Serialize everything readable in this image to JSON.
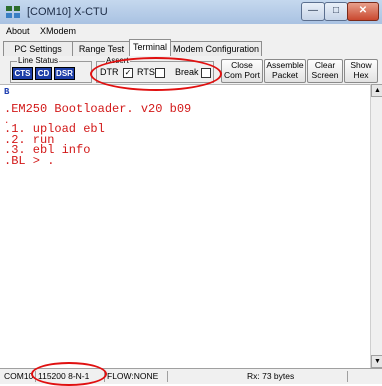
{
  "window": {
    "title": "[COM10] X-CTU",
    "min_glyph": "—",
    "max_glyph": "□",
    "close_glyph": "✕"
  },
  "menu": [
    "About",
    "XModem"
  ],
  "tabs": [
    {
      "label": "PC Settings",
      "active": false
    },
    {
      "label": "Range Test",
      "active": false
    },
    {
      "label": "Terminal",
      "active": true
    },
    {
      "label": "Modem Configuration",
      "active": false
    }
  ],
  "line_status": {
    "label": "Line Status",
    "indicators": [
      "CTS",
      "CD",
      "DSR"
    ]
  },
  "assert": {
    "label": "Assert",
    "dtr": {
      "label": "DTR",
      "checked": true,
      "mark": "✓"
    },
    "rts": {
      "label": "RTS",
      "checked": false
    },
    "break": {
      "label": "Break",
      "checked": false
    }
  },
  "buttons": {
    "close_com_port": [
      "Close",
      "Com Port"
    ],
    "assemble_packet": [
      "Assemble",
      "Packet"
    ],
    "clear_screen": [
      "Clear",
      "Screen"
    ],
    "show_hex": [
      "Show",
      "Hex"
    ]
  },
  "console": {
    "lines": [
      "B",
      "",
      ".EM250 Bootloader. v20 b09",
      ".",
      ".1. upload ebl",
      ".2. run",
      ".3. ebl info",
      ".BL > ."
    ]
  },
  "scrollbar": {
    "up": "▲",
    "down": "▼"
  },
  "status": {
    "port": "COM10",
    "settings": "115200 8-N-1",
    "flow": "FLOW:NONE",
    "rx": "Rx: 73 bytes"
  },
  "colors": {
    "console_text": "#d21818",
    "highlight_ellipse": "#e01010",
    "led_indicator": "#1d3ea8"
  }
}
